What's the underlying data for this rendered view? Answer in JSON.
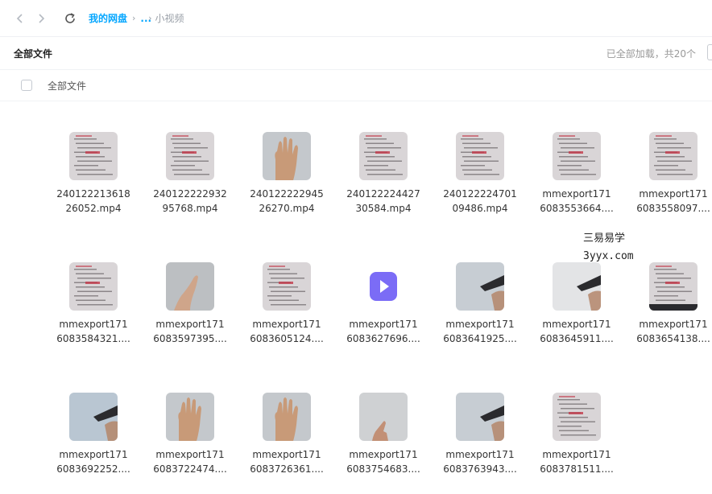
{
  "breadcrumb": {
    "root": "我的网盘",
    "ellipsis": "...",
    "current": "小视频"
  },
  "header": {
    "title": "全部文件",
    "status": "已全部加载，共20个"
  },
  "select_all": {
    "label": "全部文件"
  },
  "watermark": {
    "line1": "三易易学",
    "line2": "3yyx.com"
  },
  "icons": {
    "back": "chevron-left-icon",
    "forward": "chevron-right-icon",
    "refresh": "refresh-icon",
    "video": "video-file-icon"
  },
  "accent": "#06a7ff",
  "files": [
    {
      "line1": "240122213618",
      "line2": "26052.mp4",
      "thumb": "doc"
    },
    {
      "line1": "240122222932",
      "line2": "95768.mp4",
      "thumb": "doc"
    },
    {
      "line1": "240122222945",
      "line2": "26270.mp4",
      "thumb": "hand"
    },
    {
      "line1": "240122224427",
      "line2": "30584.mp4",
      "thumb": "doc"
    },
    {
      "line1": "240122224701",
      "line2": "09486.mp4",
      "thumb": "doc"
    },
    {
      "line1": "mmexport171",
      "line2": "6083553664....",
      "thumb": "doc"
    },
    {
      "line1": "mmexport171",
      "line2": "6083558097....",
      "thumb": "doc"
    },
    {
      "line1": "mmexport171",
      "line2": "6083584321....",
      "thumb": "doc"
    },
    {
      "line1": "mmexport171",
      "line2": "6083597395....",
      "thumb": "hand-side"
    },
    {
      "line1": "mmexport171",
      "line2": "6083605124....",
      "thumb": "doc"
    },
    {
      "line1": "mmexport171",
      "line2": "6083627696....",
      "thumb": "video-icon"
    },
    {
      "line1": "mmexport171",
      "line2": "6083641925....",
      "thumb": "pen"
    },
    {
      "line1": "mmexport171",
      "line2": "6083645911....",
      "thumb": "pen-light"
    },
    {
      "line1": "mmexport171",
      "line2": "6083654138....",
      "thumb": "doc-dark"
    },
    {
      "line1": "mmexport171",
      "line2": "6083692252....",
      "thumb": "pen-blue"
    },
    {
      "line1": "mmexport171",
      "line2": "6083722474....",
      "thumb": "hand"
    },
    {
      "line1": "mmexport171",
      "line2": "6083726361....",
      "thumb": "hand"
    },
    {
      "line1": "mmexport171",
      "line2": "6083754683....",
      "thumb": "finger"
    },
    {
      "line1": "mmexport171",
      "line2": "6083763943....",
      "thumb": "pen"
    },
    {
      "line1": "mmexport171",
      "line2": "6083781511....",
      "thumb": "doc"
    }
  ]
}
